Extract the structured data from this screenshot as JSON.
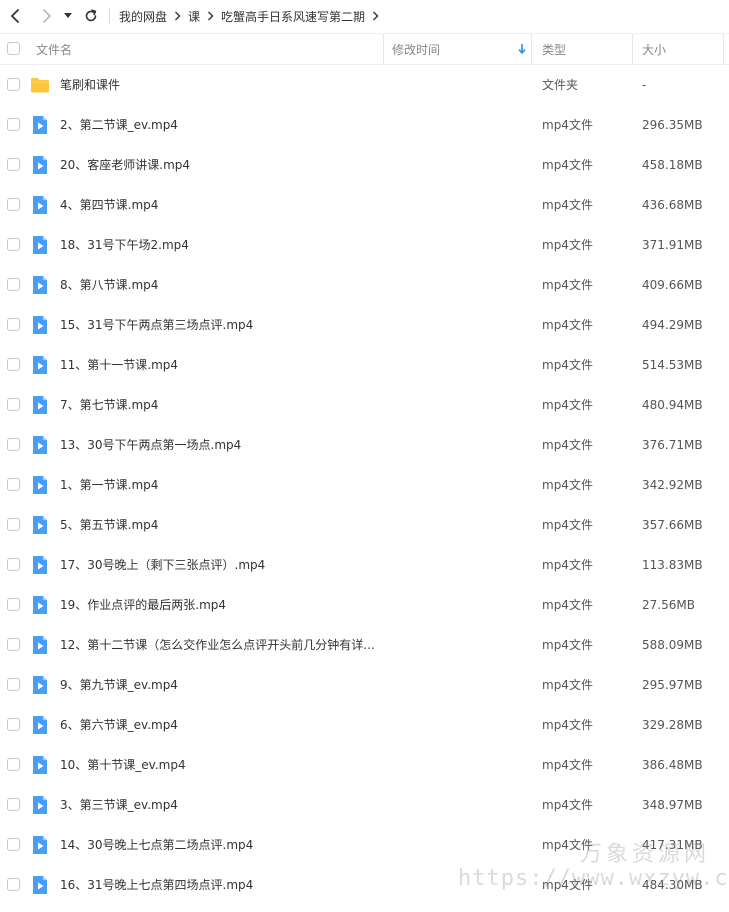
{
  "nav": {
    "back_icon": "chevron-left-icon",
    "forward_icon": "chevron-right-icon",
    "dropdown_icon": "caret-down-icon",
    "refresh_icon": "refresh-icon"
  },
  "breadcrumb": [
    "我的网盘",
    "课",
    "吃蟹高手日系风速写第二期"
  ],
  "columns": {
    "name": "文件名",
    "modified": "修改时间",
    "type": "类型",
    "size": "大小"
  },
  "colors": {
    "folder": "#FFC53D",
    "video_icon": "#4A9FF5",
    "sort_arrow": "#2F8CF4"
  },
  "files": [
    {
      "name": "笔刷和课件",
      "type": "文件夹",
      "size": "-",
      "kind": "folder"
    },
    {
      "name": "2、第二节课_ev.mp4",
      "type": "mp4文件",
      "size": "296.35MB",
      "kind": "video"
    },
    {
      "name": "20、客座老师讲课.mp4",
      "type": "mp4文件",
      "size": "458.18MB",
      "kind": "video"
    },
    {
      "name": "4、第四节课.mp4",
      "type": "mp4文件",
      "size": "436.68MB",
      "kind": "video"
    },
    {
      "name": "18、31号下午场2.mp4",
      "type": "mp4文件",
      "size": "371.91MB",
      "kind": "video"
    },
    {
      "name": "8、第八节课.mp4",
      "type": "mp4文件",
      "size": "409.66MB",
      "kind": "video"
    },
    {
      "name": "15、31号下午两点第三场点评.mp4",
      "type": "mp4文件",
      "size": "494.29MB",
      "kind": "video"
    },
    {
      "name": "11、第十一节课.mp4",
      "type": "mp4文件",
      "size": "514.53MB",
      "kind": "video"
    },
    {
      "name": "7、第七节课.mp4",
      "type": "mp4文件",
      "size": "480.94MB",
      "kind": "video"
    },
    {
      "name": "13、30号下午两点第一场点.mp4",
      "type": "mp4文件",
      "size": "376.71MB",
      "kind": "video"
    },
    {
      "name": "1、第一节课.mp4",
      "type": "mp4文件",
      "size": "342.92MB",
      "kind": "video"
    },
    {
      "name": "5、第五节课.mp4",
      "type": "mp4文件",
      "size": "357.66MB",
      "kind": "video"
    },
    {
      "name": "17、30号晚上（剩下三张点评）.mp4",
      "type": "mp4文件",
      "size": "113.83MB",
      "kind": "video"
    },
    {
      "name": "19、作业点评的最后两张.mp4",
      "type": "mp4文件",
      "size": "27.56MB",
      "kind": "video"
    },
    {
      "name": "12、第十二节课（怎么交作业怎么点评开头前几分钟有详...",
      "type": "mp4文件",
      "size": "588.09MB",
      "kind": "video"
    },
    {
      "name": "9、第九节课_ev.mp4",
      "type": "mp4文件",
      "size": "295.97MB",
      "kind": "video"
    },
    {
      "name": "6、第六节课_ev.mp4",
      "type": "mp4文件",
      "size": "329.28MB",
      "kind": "video"
    },
    {
      "name": "10、第十节课_ev.mp4",
      "type": "mp4文件",
      "size": "386.48MB",
      "kind": "video"
    },
    {
      "name": "3、第三节课_ev.mp4",
      "type": "mp4文件",
      "size": "348.97MB",
      "kind": "video"
    },
    {
      "name": "14、30号晚上七点第二场点评.mp4",
      "type": "mp4文件",
      "size": "417.31MB",
      "kind": "video"
    },
    {
      "name": "16、31号晚上七点第四场点评.mp4",
      "type": "mp4文件",
      "size": "484.30MB",
      "kind": "video"
    }
  ],
  "watermark": {
    "cn": "万象资源网",
    "url": "https://www.wxzyw.cn"
  }
}
